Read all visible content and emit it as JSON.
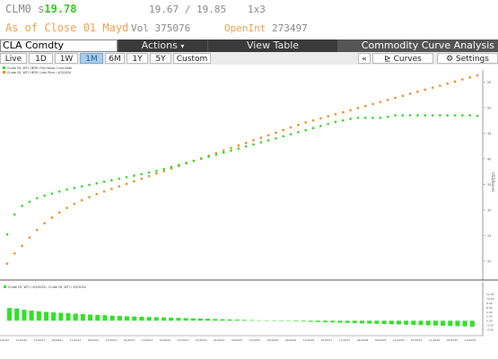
{
  "quote": {
    "symbol": "CLM0",
    "side_marker": "s",
    "price": "19.78",
    "bid_ask": "19.67 / 19.85",
    "size": "1x3",
    "as_of": "As of Close 01 Mayd",
    "vol_label": "Vol",
    "vol_value": "375076",
    "oi_label": "OpenInt",
    "oi_value": "273497"
  },
  "toolbar": {
    "ticker_input": "CLA Comdty",
    "actions_label": "Actions",
    "view_table_label": "View Table",
    "title": "Commodity Curve Analysis"
  },
  "range_tabs": [
    "Live",
    "1D",
    "1W",
    "1M",
    "6M",
    "1Y",
    "5Y",
    "Custom"
  ],
  "active_tab": "1M",
  "right_controls": {
    "collapse": "«",
    "curves_label": "Curves",
    "settings_label": "Settings"
  },
  "colors": {
    "live_curve": "#34d92a",
    "past_curve": "#f08c1e",
    "spread_bars": "#34e02a"
  },
  "chart_data": [
    {
      "type": "line",
      "legend": [
        "Crude Oil, WTI / BFM / Fair Value / Live Data",
        "Crude Oil, WTI / BFM / Last Price / 4/3/2020"
      ],
      "ylabel": "USD/barrel",
      "ylim": [
        17,
        57
      ],
      "yticks": [
        20,
        25,
        30,
        35,
        40,
        45,
        50,
        55
      ],
      "series": [
        {
          "name": "Crude Oil, WTI / BFM / Fair Value / Live Data",
          "values": [
            25.2,
            29.1,
            30.8,
            31.6,
            32.3,
            32.8,
            33.2,
            33.6,
            34.0,
            34.3,
            34.6,
            34.9,
            35.2,
            35.5,
            35.8,
            36.1,
            36.4,
            36.7,
            37.0,
            37.3,
            37.6,
            38.0,
            38.4,
            38.8,
            39.2,
            39.6,
            40.0,
            40.4,
            40.8,
            41.2,
            41.6,
            42.0,
            42.4,
            42.8,
            43.2,
            43.6,
            44.0,
            44.4,
            44.8,
            45.2,
            45.6,
            46.0,
            46.4,
            46.8,
            47.2,
            47.5,
            47.8,
            48.0,
            48.0,
            48.0,
            48.0,
            48.2,
            48.5,
            48.5,
            48.5,
            48.5,
            48.5,
            48.5,
            48.5,
            48.5,
            48.5,
            48.5,
            48.5,
            48.4
          ]
        },
        {
          "name": "Crude Oil, WTI / BFM / Last Price / 4/3/2020",
          "values": [
            19.5,
            21.5,
            23.0,
            24.6,
            26.1,
            27.4,
            28.5,
            29.5,
            30.4,
            31.2,
            31.9,
            32.5,
            33.1,
            33.6,
            34.1,
            34.6,
            35.1,
            35.6,
            36.1,
            36.6,
            37.1,
            37.6,
            38.1,
            38.6,
            39.1,
            39.6,
            40.1,
            40.6,
            41.1,
            41.6,
            42.1,
            42.6,
            43.1,
            43.6,
            44.1,
            44.6,
            45.1,
            45.6,
            46.1,
            46.6,
            47.1,
            47.5,
            47.9,
            48.3,
            48.7,
            49.1,
            49.5,
            49.9,
            50.3,
            50.7,
            51.1,
            51.5,
            51.9,
            52.3,
            52.7,
            53.1,
            53.5,
            53.9,
            54.3,
            54.7,
            55.1,
            55.5,
            55.9,
            56.3
          ]
        }
      ]
    },
    {
      "type": "bar",
      "legend": [
        "Crude Oil, WTI / 4/3/2020 - Crude Oil, WTI / 3/3/2020"
      ],
      "ylim": [
        -6,
        12
      ],
      "yticks": [
        "12.00",
        "10.00",
        "8.00",
        "6.00",
        "4.00",
        "2.00",
        "0.00",
        "-2.00",
        "-4.00"
      ],
      "xticks": [
        "05/2020",
        "12/2020",
        "10/2021",
        "08/2021",
        "11/2022",
        "06/2022",
        "12/2022",
        "04/2023",
        "10/2023",
        "04/2024",
        "07/2024",
        "12/2024",
        "02/2025",
        "06/2025",
        "10/2025",
        "04/2026",
        "09/2026",
        "12/2026",
        "04/2027",
        "11/2027",
        "04/2028",
        "09/2028",
        "12/2028",
        "07/2029",
        "11/2029",
        "05/2030",
        "10/2030"
      ],
      "values": [
        5.8,
        5.6,
        5.0,
        4.6,
        4.3,
        4.0,
        3.8,
        3.6,
        3.4,
        3.2,
        3.0,
        2.8,
        2.6,
        2.5,
        2.3,
        2.2,
        2.0,
        1.9,
        1.8,
        1.7,
        1.6,
        1.5,
        1.4,
        1.3,
        1.2,
        1.1,
        1.0,
        0.9,
        0.8,
        0.7,
        0.6,
        0.5,
        0.4,
        0.3,
        0.2,
        0.1,
        0.0,
        -0.1,
        -0.2,
        -0.3,
        -0.4,
        -0.5,
        -0.6,
        -0.7,
        -0.8,
        -0.9,
        -1.0,
        -1.1,
        -1.2,
        -1.3,
        -1.4,
        -1.5,
        -1.6,
        -1.7,
        -1.8,
        -1.9,
        -2.0,
        -2.1,
        -2.2,
        -2.3,
        -2.4,
        -2.5,
        -2.6,
        -2.7
      ]
    }
  ]
}
